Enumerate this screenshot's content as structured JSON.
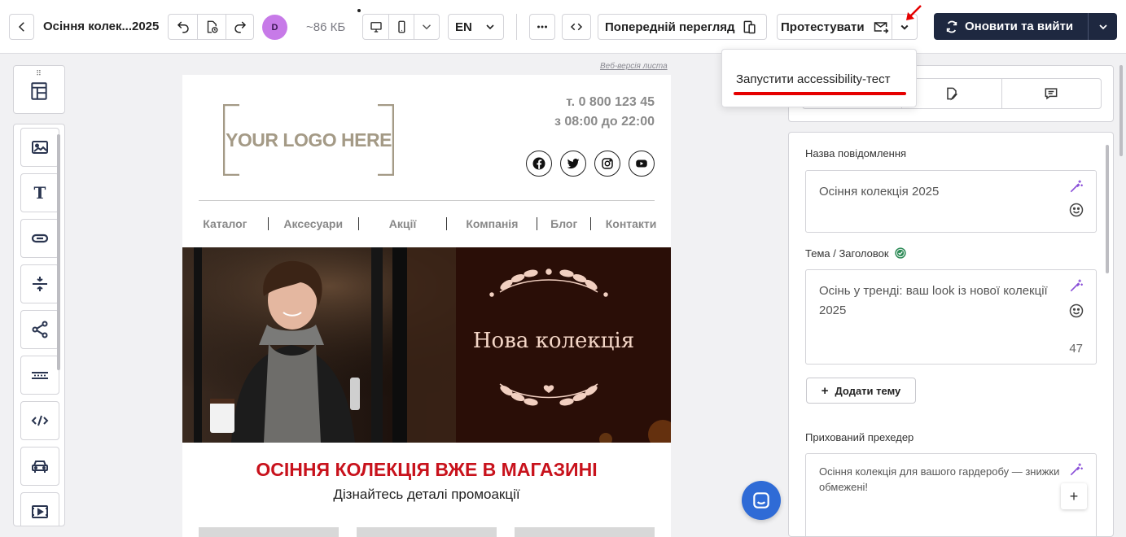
{
  "header": {
    "doc_title": "Осіння колек...2025",
    "avatar_initial": "D",
    "size_label": "~86 КБ",
    "language": "EN",
    "preview_label": "Попередній перегляд",
    "test_label": "Протестувати",
    "primary_label": "Оновити та вийти"
  },
  "dropdown": {
    "item": "Запустити accessibility-тест"
  },
  "left_tools": [
    {
      "name": "image-tool",
      "icon": "image-icon"
    },
    {
      "name": "text-tool",
      "icon": "text-icon"
    },
    {
      "name": "button-tool",
      "icon": "button-icon"
    },
    {
      "name": "spacer-tool",
      "icon": "spacer-icon"
    },
    {
      "name": "social-tool",
      "icon": "share-icon"
    },
    {
      "name": "menu-tool",
      "icon": "menu-icon"
    },
    {
      "name": "html-tool",
      "icon": "code-icon"
    },
    {
      "name": "amp-tool",
      "icon": "car-icon"
    },
    {
      "name": "video-tool",
      "icon": "video-icon"
    }
  ],
  "email": {
    "web_version": "Веб-версія листа",
    "logo_text": "YOUR LOGO HERE",
    "phone_line1": "т. 0 800 123 45",
    "phone_line2": "з 08:00 до 22:00",
    "menu": [
      "Каталог",
      "Аксесуари",
      "Акції",
      "Компанія",
      "Блог",
      "Контакти"
    ],
    "hero_title": "Нова колекція",
    "promo_heading": "ОСІННЯ КОЛЕКЦІЯ ВЖЕ В МАГАЗИНІ",
    "promo_sub": "Дізнайтесь деталі промоакції"
  },
  "settings": {
    "message_name_label": "Назва повідомлення",
    "message_name_value": "Осіння колекція 2025",
    "subject_label": "Тема / Заголовок",
    "subject_value": "Осінь у тренді: ваш look із нової колекції 2025",
    "subject_count": "47",
    "add_theme_label": "Додати тему",
    "preheader_label": "Прихований прехедер",
    "preheader_value": "Осіння колекція для вашого гардеробу — знижки обмежені!"
  },
  "colors": {
    "primary_bg": "#1e2840",
    "accent_red": "#c8121c",
    "avatar_bg": "#c77ae8",
    "chat_blue": "#2f6bd6",
    "wand_purple": "#8a4fd8"
  }
}
